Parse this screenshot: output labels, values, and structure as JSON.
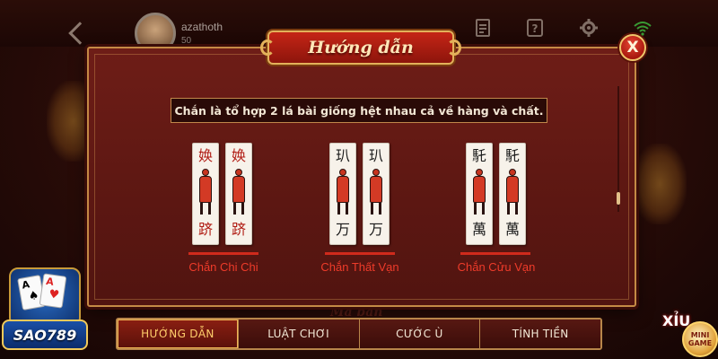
{
  "player": {
    "name": "azathoth",
    "level": "50"
  },
  "background": {
    "faint_text": "Ma bàn"
  },
  "modal": {
    "title": "Hướng dẫn",
    "close_label": "X",
    "description": "Chắn là tổ hợp 2 lá bài giống hệt nhau cả về hàng và chất."
  },
  "card_groups": [
    {
      "label": "Chắn Chi Chi",
      "glyph_top": "㛟",
      "glyph_bottom": "跻",
      "glyph_color": "#b01a12"
    },
    {
      "label": "Chắn Thất Vạn",
      "glyph_top": "玐",
      "glyph_bottom": "万",
      "glyph_color": "#1a1a1a"
    },
    {
      "label": "Chắn Cửu Vạn",
      "glyph_top": "馲",
      "glyph_bottom": "萬",
      "glyph_color": "#1a1a1a"
    }
  ],
  "tabs": [
    {
      "label": "HƯỚNG DẪN",
      "active": true
    },
    {
      "label": "LUẬT CHƠI",
      "active": false
    },
    {
      "label": "CƯỚC Ù",
      "active": false
    },
    {
      "label": "TÍNH TIỀN",
      "active": false
    }
  ],
  "brand": {
    "name": "SAO789",
    "card_rank": "A"
  },
  "minigame": {
    "xiu": "XỈU",
    "line1": "MINI",
    "line2": "GAME"
  },
  "colors": {
    "modal_bg": "#5c1712",
    "accent_gold": "#c48a45",
    "label_red": "#ef3b2a",
    "active_tab_text": "#ffce6b"
  },
  "icons": [
    "back-chevron-icon",
    "document-icon",
    "help-icon",
    "gear-icon",
    "wifi-icon",
    "close-icon"
  ]
}
